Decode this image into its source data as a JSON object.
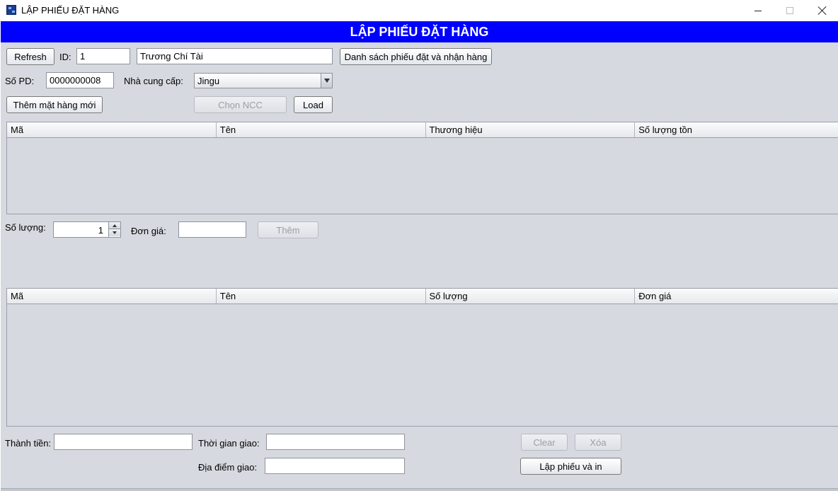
{
  "window": {
    "title": "LẬP PHIẾU ĐẶT HÀNG",
    "controls": {
      "minimize": "minimize",
      "maximize": "maximize",
      "close": "close"
    }
  },
  "banner": {
    "title": "LẬP PHIẾU ĐẶT HÀNG",
    "color": "#0000ff"
  },
  "toolbar": {
    "refresh_label": "Refresh",
    "id_label": "ID:",
    "id_value": "1",
    "name_value": "Trương Chí Tài",
    "list_orders_label": "Danh sách phiếu đặt và nhận hàng"
  },
  "order": {
    "order_no_label": "Số PD:",
    "order_no_value": "0000000008",
    "supplier_label": "Nhà cung cấp:",
    "supplier_selected": "Jingu"
  },
  "actions": {
    "add_new_item_label": "Thêm mặt hàng mới",
    "choose_supplier_label": "Chọn NCC",
    "load_label": "Load"
  },
  "products_table": {
    "columns": [
      "Mã",
      "Tên",
      "Thương hiệu",
      "Số lượng tồn"
    ],
    "rows": []
  },
  "entry": {
    "quantity_label": "Số lượng:",
    "quantity_value": "1",
    "unit_price_label": "Đơn giá:",
    "unit_price_value": "",
    "add_label": "Thêm"
  },
  "order_items_table": {
    "columns": [
      "Mã",
      "Tên",
      "Số lượng",
      "Đơn giá"
    ],
    "rows": []
  },
  "footer": {
    "total_label": "Thành tiền:",
    "total_value": "",
    "delivery_time_label": "Thời gian giao:",
    "delivery_time_value": "",
    "delivery_place_label": "Địa điểm giao:",
    "delivery_place_value": "",
    "clear_label": "Clear",
    "delete_label": "Xóa",
    "create_print_label": "Lập phiếu và in"
  }
}
